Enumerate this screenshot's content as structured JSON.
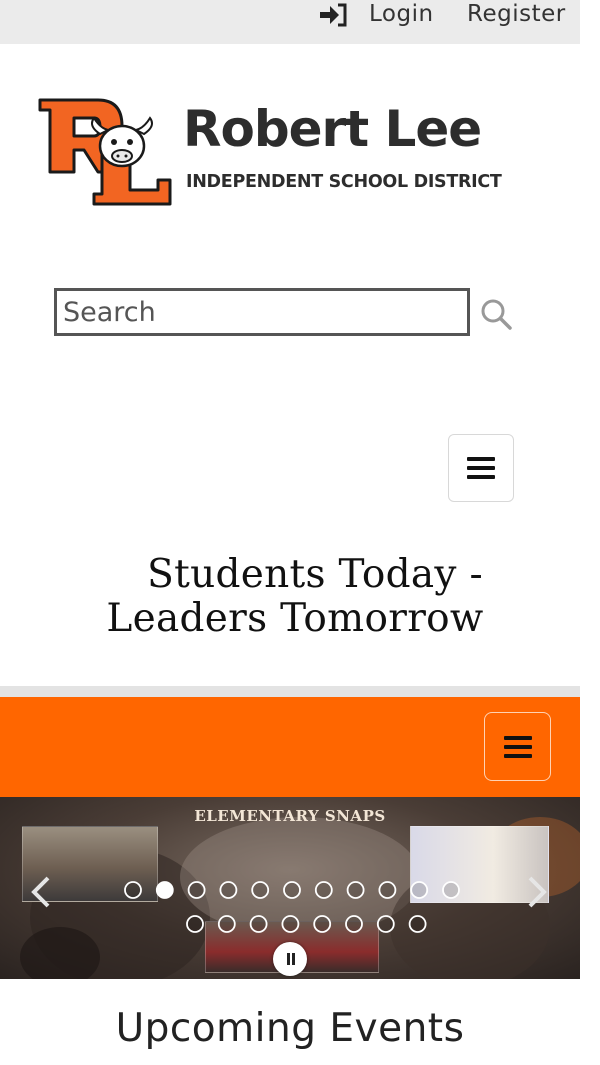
{
  "topbar": {
    "login_label": "Login",
    "register_label": "Register",
    "login_icon": "sign-in-icon"
  },
  "header": {
    "logo_letters": "RL",
    "name": "Robert Lee",
    "subtitle": "INDEPENDENT SCHOOL DISTRICT"
  },
  "search": {
    "placeholder": "Search",
    "icon": "search-icon"
  },
  "nav": {
    "menu_icon": "hamburger-menu-icon"
  },
  "tagline": {
    "line1": "Students Today -",
    "line2": "Leaders Tomorrow"
  },
  "orange_nav": {
    "menu_icon": "hamburger-menu-icon"
  },
  "slideshow": {
    "title": "ELEMENTARY SNAPS",
    "total_slides": 19,
    "active_slide": 2,
    "prev_icon": "chevron-left-icon",
    "next_icon": "chevron-right-icon",
    "pause_icon": "pause-icon"
  },
  "events": {
    "heading": "Upcoming Events"
  },
  "colors": {
    "accent_orange": "#ff6600",
    "topbar_grey": "#ebebeb",
    "text_dark": "#2d2d2d"
  }
}
